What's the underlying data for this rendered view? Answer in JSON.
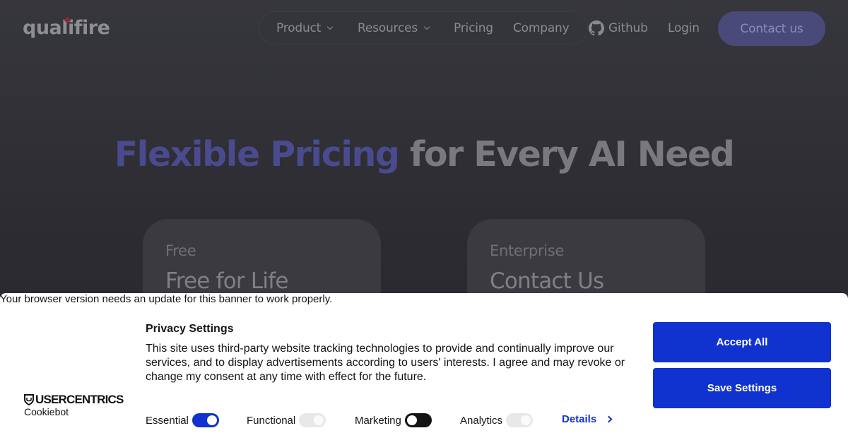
{
  "nav": {
    "logo": "qualifire",
    "links": [
      {
        "label": "Product",
        "has_dropdown": true
      },
      {
        "label": "Resources",
        "has_dropdown": true
      },
      {
        "label": "Pricing",
        "has_dropdown": false
      },
      {
        "label": "Company",
        "has_dropdown": false
      }
    ],
    "github": {
      "label": "Github",
      "icon": "github-icon"
    },
    "login": "Login",
    "contact": "Contact us"
  },
  "hero": {
    "accent": "Flexible Pricing",
    "rest": "for Every AI Need"
  },
  "plans": [
    {
      "label": "Free",
      "title": "Free for Life"
    },
    {
      "label": "Enterprise",
      "title": "Contact Us"
    }
  ],
  "banner": {
    "browser_warning": "Your browser version needs an update for this banner to work properly.",
    "brand": {
      "name": "USERCENTRICS",
      "sub": "Cookiebot",
      "icon": "shield-icon"
    },
    "title": "Privacy Settings",
    "body": "This site uses third-party website tracking technologies to provide and continually improve our services, and to display advertisements according to users' interests. I agree and may revoke or change my consent at any time with effect for the future.",
    "toggles": [
      {
        "label": "Essential",
        "state": "on-locked"
      },
      {
        "label": "Functional",
        "state": "off-disabled"
      },
      {
        "label": "Marketing",
        "state": "off"
      },
      {
        "label": "Analytics",
        "state": "off-disabled"
      }
    ],
    "details": "Details",
    "accept_all": "Accept All",
    "save_settings": "Save Settings"
  },
  "colors": {
    "brand_blue": "#1032cf",
    "hero_accent": "#4a4a8e",
    "page_bg": "#2a2a2e"
  }
}
